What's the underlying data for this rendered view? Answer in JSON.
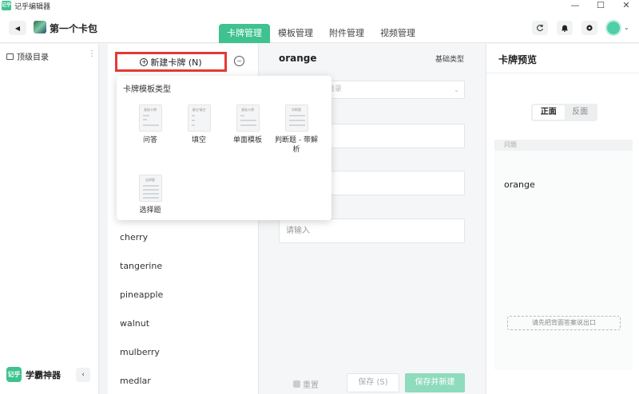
{
  "window": {
    "app_icon_text": "记乎",
    "title": "记乎编辑器",
    "controls": [
      "—",
      "☐",
      "✕"
    ]
  },
  "header": {
    "pack_name": "第一个卡包",
    "tabs": [
      {
        "label": "卡牌管理",
        "active": true
      },
      {
        "label": "模板管理",
        "active": false
      },
      {
        "label": "附件管理",
        "active": false
      },
      {
        "label": "视频管理",
        "active": false
      }
    ],
    "icons": [
      "refresh-icon",
      "bell-icon",
      "settings-icon"
    ]
  },
  "sidebar": {
    "root_label": "顶级目录",
    "brand_logo_text": "记乎",
    "brand_name": "学霸神器"
  },
  "card_list": {
    "new_button_label": "新建卡牌 (N)",
    "items": [
      "cherry",
      "tangerine",
      "pineapple",
      "walnut",
      "mulberry",
      "medlar"
    ]
  },
  "template_popover": {
    "title": "卡牌模板类型",
    "templates": [
      {
        "thumb_label": "基础卡牌",
        "label": "问答"
      },
      {
        "thumb_label": "填空/填空",
        "label": "填空"
      },
      {
        "thumb_label": "基础卡牌",
        "label": "单面模板"
      },
      {
        "thumb_label": "判断题",
        "label": "判断题 - 带解析"
      },
      {
        "thumb_label": "选择题",
        "label": "选择题"
      }
    ]
  },
  "editor": {
    "title": "orange",
    "type_label": "基础类型",
    "select_placeholder": "目录",
    "input_placeholder": "请输入",
    "reset_label": "重置",
    "save_label": "保存 (S)",
    "save_new_label": "保存并新建"
  },
  "preview": {
    "title": "卡牌预览",
    "toggle_front": "正面",
    "toggle_back": "反面",
    "question_label": "问题",
    "question_text": "orange",
    "hint": "请先把背面答案说出口"
  },
  "colors": {
    "accent": "#3ec28f",
    "highlight_border": "#e53935"
  }
}
